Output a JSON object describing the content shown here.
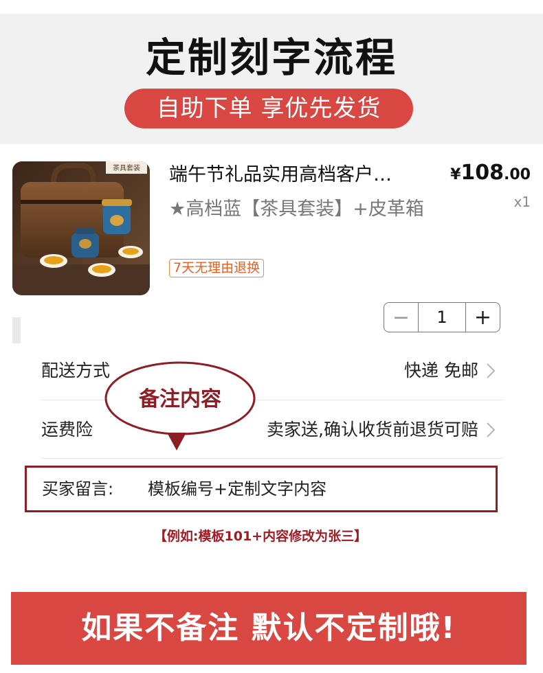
{
  "header": {
    "title": "定制刻字流程",
    "subtitle": "自助下单 享优先发货"
  },
  "product": {
    "image_label": "茶具套装",
    "title": "端午节礼品实用高档客户…",
    "spec": "★高档蓝【茶具套装】+皮革箱",
    "badge": "7天无理由退换",
    "price_currency": "¥",
    "price_int": "108",
    "price_dec": ".00",
    "qty_mark": "x1"
  },
  "stepper": {
    "minus": "−",
    "value": "1",
    "plus": "+"
  },
  "rows": {
    "delivery_label": "配送方式",
    "delivery_value": "快递 免邮",
    "insurance_label": "运费险",
    "insurance_value": "卖家送,确认收货前退货可赔"
  },
  "callout": {
    "text": "备注内容"
  },
  "message": {
    "label": "买家留言:",
    "value": "模板编号+定制文字内容"
  },
  "example": "【例如:模板101+内容修改为张三】",
  "footer": "如果不备注 默认不定制哦!",
  "colors": {
    "accent_red": "#d94742",
    "dark_red": "#8d1e26",
    "badge_orange": "#ea5f20"
  }
}
